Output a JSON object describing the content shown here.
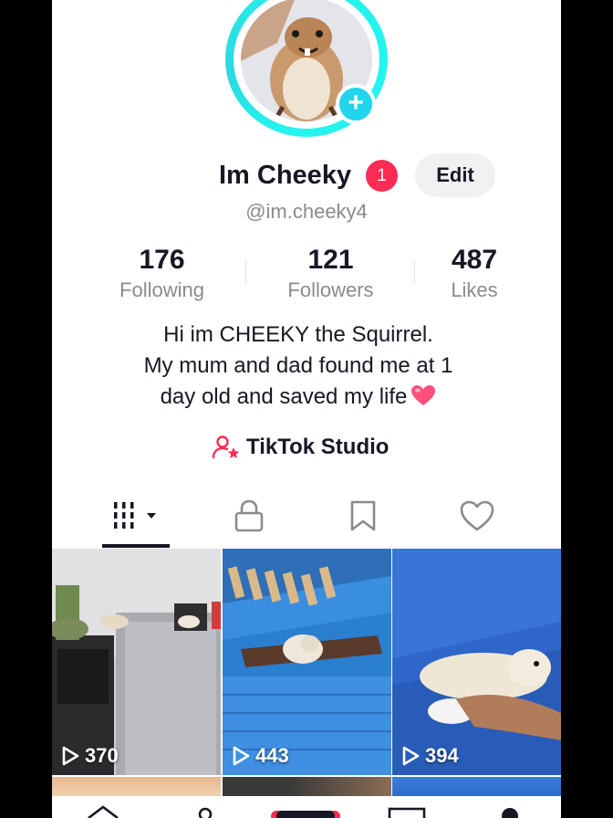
{
  "profile": {
    "display_name": "Im Cheeky",
    "notification_count": "1",
    "handle": "@im.cheeky4",
    "edit_label": "Edit",
    "avatar_icon": "plus-icon"
  },
  "stats": [
    {
      "value": "176",
      "label": "Following"
    },
    {
      "value": "121",
      "label": "Followers"
    },
    {
      "value": "487",
      "label": "Likes"
    }
  ],
  "bio": {
    "line1": "Hi im CHEEKY the Squirrel.",
    "line2": "My mum and dad found me at 1",
    "line3": "day old and saved my life"
  },
  "studio": {
    "label": "TikTok Studio",
    "icon": "creator-star-icon"
  },
  "tabs": [
    {
      "name": "videos",
      "icon": "grid-icon"
    },
    {
      "name": "private",
      "icon": "lock-icon"
    },
    {
      "name": "favorites",
      "icon": "bookmark-icon"
    },
    {
      "name": "liked",
      "icon": "heart-icon"
    }
  ],
  "videos": [
    {
      "views": "370"
    },
    {
      "views": "443"
    },
    {
      "views": "394"
    }
  ],
  "colors": {
    "accent_red": "#fe2c55",
    "accent_cyan": "#20d5ec",
    "text_primary": "#161823",
    "text_secondary": "#8a8b91"
  }
}
